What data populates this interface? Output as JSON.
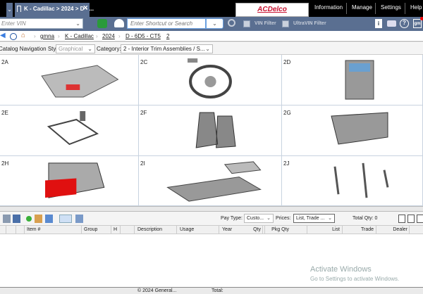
{
  "tab": {
    "title": "K - Cadillac > 2024 > D - ..."
  },
  "brand": {
    "logo": "ACDelco"
  },
  "menu": [
    "Information",
    "Manage",
    "Settings",
    "Help"
  ],
  "toolbar": {
    "vin_placeholder": "Enter VIN",
    "search_placeholder": "Enter Shortcut or Search",
    "vin_filter": "VIN Filter",
    "ultravin_filter": "UltraVIN Filter"
  },
  "breadcrumb": [
    "gmna",
    "K - Cadillac",
    "2024",
    "D - 6D5 - CT5",
    "2"
  ],
  "catalog": {
    "nav_style_label": "Catalog Navigation Style:",
    "nav_style_value": "Graphical",
    "category_label": "Category:",
    "category_value": "2 - Interior Trim Assemblies / S..."
  },
  "cells": [
    {
      "label": "2A",
      "depicts": "instrument-panel"
    },
    {
      "label": "2C",
      "depicts": "steering-wheel"
    },
    {
      "label": "2D",
      "depicts": "center-console-radio"
    },
    {
      "label": "2E",
      "depicts": "pedals-shifter"
    },
    {
      "label": "2F",
      "depicts": "front-seats"
    },
    {
      "label": "2G",
      "depicts": "rear-seat"
    },
    {
      "label": "2H",
      "depicts": "trunk-trim"
    },
    {
      "label": "2I",
      "depicts": "floor-carpet"
    },
    {
      "label": "2J",
      "depicts": "seat-belts"
    }
  ],
  "bottom": {
    "pay_type_label": "Pay Type:",
    "pay_type_value": "Custo...",
    "prices_label": "Prices:",
    "prices_value": "List, Trade ...",
    "total_qty": "Total Qty: 0"
  },
  "columns": [
    "Item #",
    "Group",
    "H",
    "Description",
    "Usage",
    "Year",
    "Qty",
    "Pkg Qty",
    "List",
    "Trade",
    "Dealer"
  ],
  "watermark": {
    "title": "Activate Windows",
    "subtitle": "Go to Settings to activate Windows."
  },
  "status": {
    "copyright": "© 2024 General...",
    "total": "Total:"
  },
  "colors": {
    "toolbar": "#5a6f91",
    "accent": "#c8102e"
  }
}
